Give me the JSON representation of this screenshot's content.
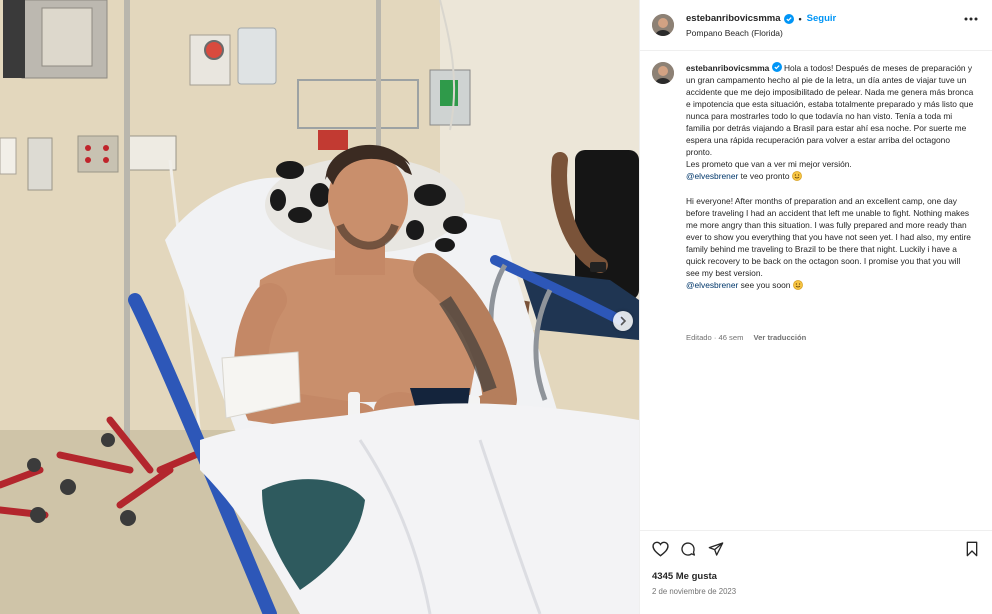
{
  "post": {
    "username": "estebanribovicsmma",
    "follow_label": "Seguir",
    "location": "Pompano Beach (Florida)",
    "caption_es": "Hola a todos! Después de meses de preparación y un gran campamento hecho al pie de la letra, un día antes de viajar tuve un accidente que me dejo imposibilitado de pelear. Nada me genera más bronca e impotencia que esta situación, estaba totalmente preparado y más listo que nunca para mostrarles todo lo que todavía no han visto. Tenía a toda mi familia por detrás viajando a Brasil para estar ahí esa noche. Por suerte me espera una rápida recuperación para volver a estar arriba del octagono pronto.\nLes prometo que van a ver mi mejor versión.",
    "mention_1": "@elvesbrener",
    "after_mention_1": " te veo pronto ",
    "caption_en": "Hi everyone! After months of preparation and an excellent camp, one day before traveling I had an accident that left me unable to fight. Nothing makes me more angry than this situation. I was fully prepared and more ready than ever to show you everything that you have not seen yet. I had also, my entire family behind me traveling to Brazil to be there that night. Luckily i have a quick recovery to be back on the octagon soon. I promise you that you will see my best version.",
    "mention_2": "@elvesbrener",
    "after_mention_2": " see you soon ",
    "edited_label": "Editado · 46 sem",
    "translate_label": "Ver traducción",
    "likes": "4345 Me gusta",
    "date": "2 de noviembre de 2023"
  },
  "icons": {
    "verified": "verified-badge",
    "more": "more-options",
    "like": "heart",
    "comment": "speech-bubble",
    "share": "paper-plane",
    "save": "bookmark",
    "next": "chevron-right"
  },
  "colors": {
    "link_blue": "#0095f6",
    "mention": "#00376b",
    "verified": "#0095f6",
    "bed_rail_blue": "#2d57b8",
    "iv_stand_red": "#b3262d"
  }
}
